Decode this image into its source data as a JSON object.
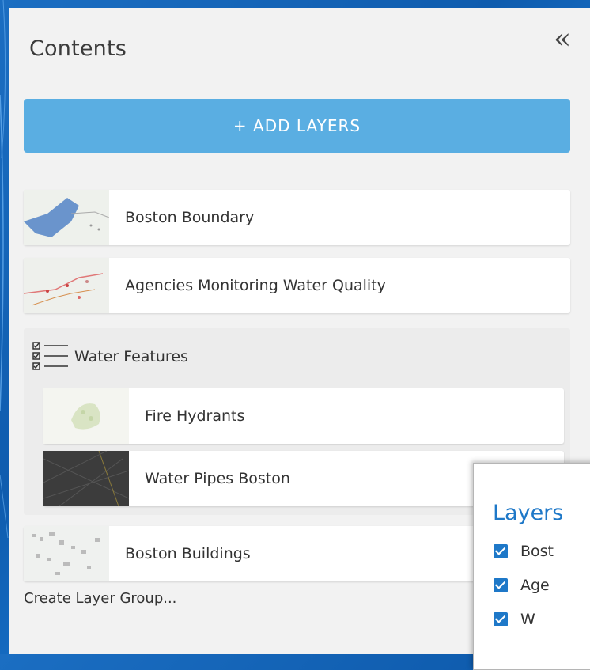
{
  "panel": {
    "title": "Contents",
    "collapse_glyph": "«",
    "add_layers_label": "+ ADD LAYERS",
    "create_group_label": "Create Layer Group..."
  },
  "layers": [
    {
      "label": "Boston Boundary",
      "thumbnail": "boundary-map-thumbnail"
    },
    {
      "label": "Agencies Monitoring Water Quality",
      "thumbnail": "agencies-map-thumbnail"
    }
  ],
  "group": {
    "label": "Water Features",
    "icon": "layer-list-icon",
    "children": [
      {
        "label": "Fire Hydrants",
        "thumbnail": "hydrants-map-thumbnail"
      },
      {
        "label": "Water Pipes Boston",
        "thumbnail": "pipes-map-thumbnail"
      }
    ]
  },
  "layers_after": [
    {
      "label": "Boston Buildings",
      "thumbnail": "buildings-map-thumbnail"
    }
  ],
  "popup": {
    "title": "Layers",
    "items": [
      {
        "label": "Bost",
        "checked": true
      },
      {
        "label": "Age",
        "checked": true
      },
      {
        "label": "W",
        "checked": true
      }
    ]
  },
  "colors": {
    "accent": "#5aaee2",
    "link_blue": "#1e78c8",
    "background_blue": "#1b6ec2"
  }
}
